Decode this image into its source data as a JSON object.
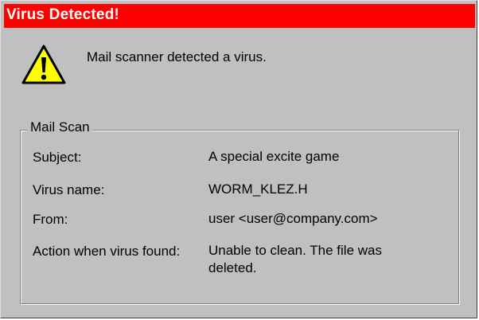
{
  "window": {
    "title": "Virus Detected!",
    "title_bar_color": "#ff0000",
    "icon": "warning-triangle-icon",
    "message": "Mail scanner detected a virus."
  },
  "mail_scan": {
    "group_label": "Mail Scan",
    "rows": [
      {
        "label": "Subject:",
        "value": "A special  excite game"
      },
      {
        "label": "Virus name:",
        "value": "WORM_KLEZ.H"
      },
      {
        "label": "From:",
        "value": "user <user@company.com>"
      },
      {
        "label": "Action when virus found:",
        "value": "Unable to clean. The file was deleted."
      }
    ]
  }
}
